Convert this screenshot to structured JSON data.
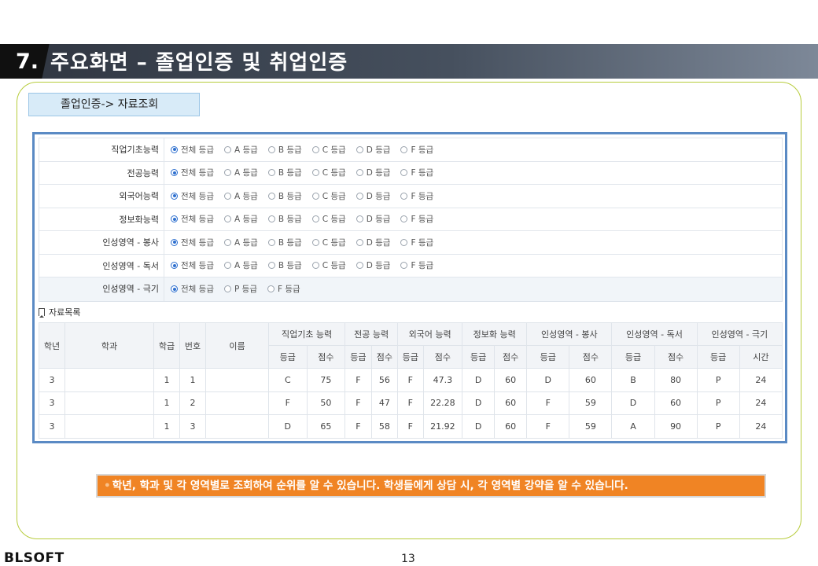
{
  "header": {
    "number": "7.",
    "title": "주요화면 –  졸업인증 및 취업인증"
  },
  "nav_label": "졸업인증-> 자료조회",
  "filters": [
    {
      "label": "직업기초능력",
      "options": [
        "전체 등급",
        "A 등급",
        "B 등급",
        "C 등급",
        "D 등급",
        "F 등급"
      ],
      "selected": 0
    },
    {
      "label": "전공능력",
      "options": [
        "전체 등급",
        "A 등급",
        "B 등급",
        "C 등급",
        "D 등급",
        "F 등급"
      ],
      "selected": 0
    },
    {
      "label": "외국어능력",
      "options": [
        "전체 등급",
        "A 등급",
        "B 등급",
        "C 등급",
        "D 등급",
        "F 등급"
      ],
      "selected": 0
    },
    {
      "label": "정보화능력",
      "options": [
        "전체 등급",
        "A 등급",
        "B 등급",
        "C 등급",
        "D 등급",
        "F 등급"
      ],
      "selected": 0
    },
    {
      "label": "인성영역 - 봉사",
      "options": [
        "전체 등급",
        "A 등급",
        "B 등급",
        "C 등급",
        "D 등급",
        "F 등급"
      ],
      "selected": 0
    },
    {
      "label": "인성영역 - 독서",
      "options": [
        "전체 등급",
        "A 등급",
        "B 등급",
        "C 등급",
        "D 등급",
        "F 등급"
      ],
      "selected": 0
    },
    {
      "label": "인성영역 - 극기",
      "options": [
        "전체 등급",
        "P 등급",
        "F 등급"
      ],
      "selected": 0
    }
  ],
  "list_title": "자료목록",
  "table": {
    "fixed_headers": [
      "학년",
      "학과",
      "학급",
      "번호",
      "이름"
    ],
    "groups": [
      {
        "name": "직업기초 능력",
        "sub": [
          "등급",
          "점수"
        ]
      },
      {
        "name": "전공 능력",
        "sub": [
          "등급",
          "점수"
        ]
      },
      {
        "name": "외국어 능력",
        "sub": [
          "등급",
          "점수"
        ]
      },
      {
        "name": "정보화 능력",
        "sub": [
          "등급",
          "점수"
        ]
      },
      {
        "name": "인성영역 - 봉사",
        "sub": [
          "등급",
          "점수"
        ]
      },
      {
        "name": "인성영역 - 독서",
        "sub": [
          "등급",
          "점수"
        ]
      },
      {
        "name": "인성영역 - 극기",
        "sub": [
          "등급",
          "시간"
        ]
      }
    ],
    "rows": [
      [
        "3",
        "",
        "1",
        "1",
        "",
        "C",
        "75",
        "F",
        "56",
        "F",
        "47.3",
        "D",
        "60",
        "D",
        "60",
        "B",
        "80",
        "P",
        "24"
      ],
      [
        "3",
        "",
        "1",
        "2",
        "",
        "F",
        "50",
        "F",
        "47",
        "F",
        "22.28",
        "D",
        "60",
        "F",
        "59",
        "D",
        "60",
        "P",
        "24"
      ],
      [
        "3",
        "",
        "1",
        "3",
        "",
        "D",
        "65",
        "F",
        "58",
        "F",
        "21.92",
        "D",
        "60",
        "F",
        "59",
        "A",
        "90",
        "P",
        "24"
      ]
    ]
  },
  "note": "학년, 학과 및 각 영역별로 조회하여 순위를 알 수 있습니다. 학생들에게 상담 시, 각 영역별 강약을 알 수 있습니다.",
  "footer": {
    "logo": "BLSOFT",
    "page": "13"
  },
  "colors": {
    "accent_blue": "#2d6fcf",
    "frame_green": "#b7cc3c",
    "note_orange": "#f08424",
    "panel_border": "#5a8ac4"
  }
}
